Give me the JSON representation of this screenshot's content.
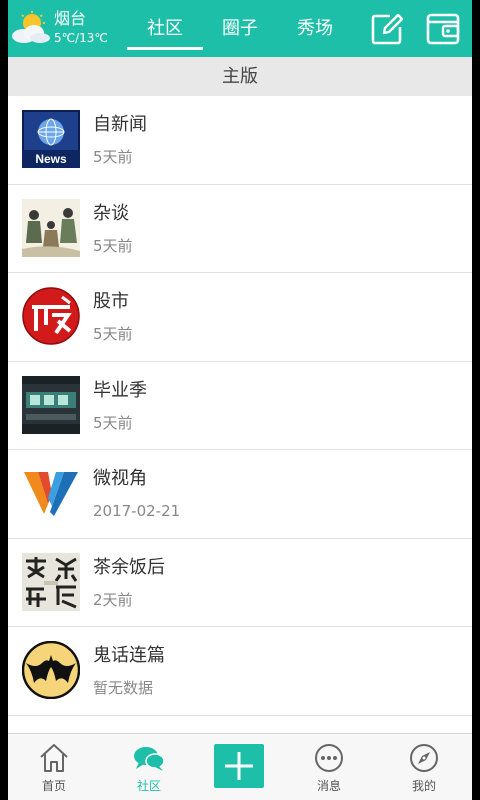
{
  "header": {
    "weather": {
      "city": "烟台",
      "temp": "5℃/13℃",
      "icon": "sun-cloud-icon"
    },
    "tabs": [
      {
        "label": "社区",
        "active": true
      },
      {
        "label": "圈子",
        "active": false
      },
      {
        "label": "秀场",
        "active": false
      }
    ],
    "actions": [
      {
        "icon": "edit-icon"
      },
      {
        "icon": "wallet-icon"
      }
    ],
    "accent": "#1ebfa8"
  },
  "section": {
    "title": "主版"
  },
  "forums": [
    {
      "title": "自新闻",
      "sub": "5天前",
      "thumb": "news-globe-icon"
    },
    {
      "title": "杂谈",
      "sub": "5天前",
      "thumb": "ink-painting-icon"
    },
    {
      "title": "股市",
      "sub": "5天前",
      "thumb": "stock-badge-icon"
    },
    {
      "title": "毕业季",
      "sub": "5天前",
      "thumb": "graduation-poster-icon"
    },
    {
      "title": "微视角",
      "sub": "2017-02-21",
      "thumb": "v-logo-icon"
    },
    {
      "title": "茶余饭后",
      "sub": "2天前",
      "thumb": "calligraphy-icon"
    },
    {
      "title": "鬼话连篇",
      "sub": "暂无数据",
      "thumb": "bat-moon-icon"
    }
  ],
  "bottom_nav": [
    {
      "label": "首页",
      "icon": "home-icon",
      "active": false
    },
    {
      "label": "社区",
      "icon": "chat-bubbles-icon",
      "active": true
    },
    {
      "label": "",
      "icon": "plus-icon",
      "active": false
    },
    {
      "label": "消息",
      "icon": "message-icon",
      "active": false
    },
    {
      "label": "我的",
      "icon": "compass-icon",
      "active": false
    }
  ]
}
